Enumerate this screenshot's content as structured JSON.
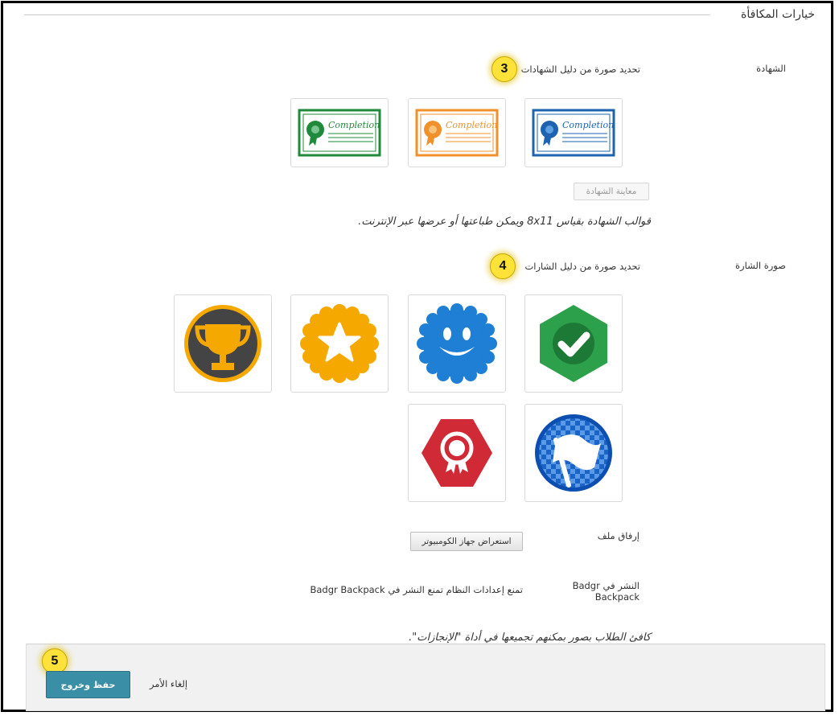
{
  "section": {
    "title": "خيارات المكافأة"
  },
  "certificate": {
    "label": "الشهادة",
    "instruction": "تحديد صورة من دليل الشهادات",
    "callout": "3",
    "templates": [
      {
        "name": "blue",
        "color": "#1e63b0",
        "text": "Completion"
      },
      {
        "name": "orange",
        "color": "#f0912b",
        "text": "Completion"
      },
      {
        "name": "green",
        "color": "#1f8a3b",
        "text": "Completion"
      }
    ],
    "preview_button": "معاينة الشهادة",
    "help": "قوالب الشهادة بقياس 8x11 ويمكن طباعتها أو عرضها عبر الإنترنت."
  },
  "badge": {
    "label": "صورة الشارة",
    "instruction": "تحديد صورة من دليل الشارات",
    "callout": "4",
    "images": [
      {
        "name": "green-check-hexagon",
        "color": "#2ca04a"
      },
      {
        "name": "blue-smiley-seal",
        "color": "#1f7fd4"
      },
      {
        "name": "gold-star-seal",
        "color": "#f5a800"
      },
      {
        "name": "trophy-circle",
        "color": "#444444"
      },
      {
        "name": "blue-flag-circle",
        "color": "#1a63c7"
      },
      {
        "name": "red-ribbon-hexagon",
        "color": "#d02a36"
      }
    ]
  },
  "attach": {
    "label": "إرفاق ملف",
    "button": "استعراض جهاز الكومبيوتر"
  },
  "publish": {
    "label_line1": "النشر في Badgr",
    "label_line2": "Backpack",
    "message": "تمنع إعدادات النظام تمنع النشر في Badgr Backpack"
  },
  "rewards_help": "كافئ الطلاب بصور بمكنهم تجميعها في أداة \"الإنجازات\".",
  "footer": {
    "callout": "5",
    "save_button": "حفظ وخروج",
    "cancel": "إلغاء الأمر"
  }
}
